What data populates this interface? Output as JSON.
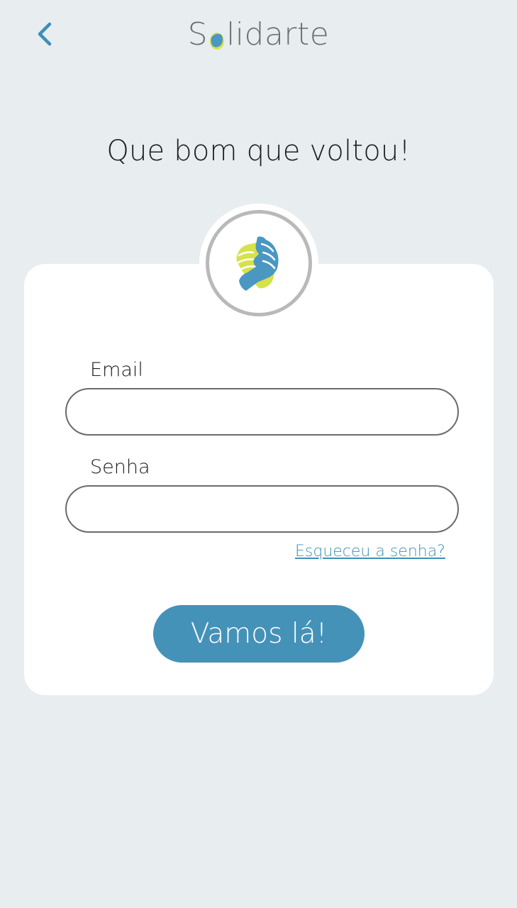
{
  "header": {
    "back_icon": "chevron-left-icon",
    "brand_prefix": "S",
    "brand_suffix": "lidarte",
    "brand_mark_icon": "handshake-icon"
  },
  "headline": "Que bom que voltou!",
  "logo": {
    "icon": "handshake-icon"
  },
  "form": {
    "email_label": "Email",
    "email_value": "",
    "password_label": "Senha",
    "password_value": "",
    "forgot_link": "Esqueceu a senha?",
    "submit_label": "Vamos lá!"
  },
  "colors": {
    "accent": "#4592b8",
    "link": "#3d8fb6",
    "hand_blue": "#4a97c2",
    "hand_yellow": "#d6e24a",
    "background": "#e8edf0",
    "ring": "#b9b9b9"
  }
}
